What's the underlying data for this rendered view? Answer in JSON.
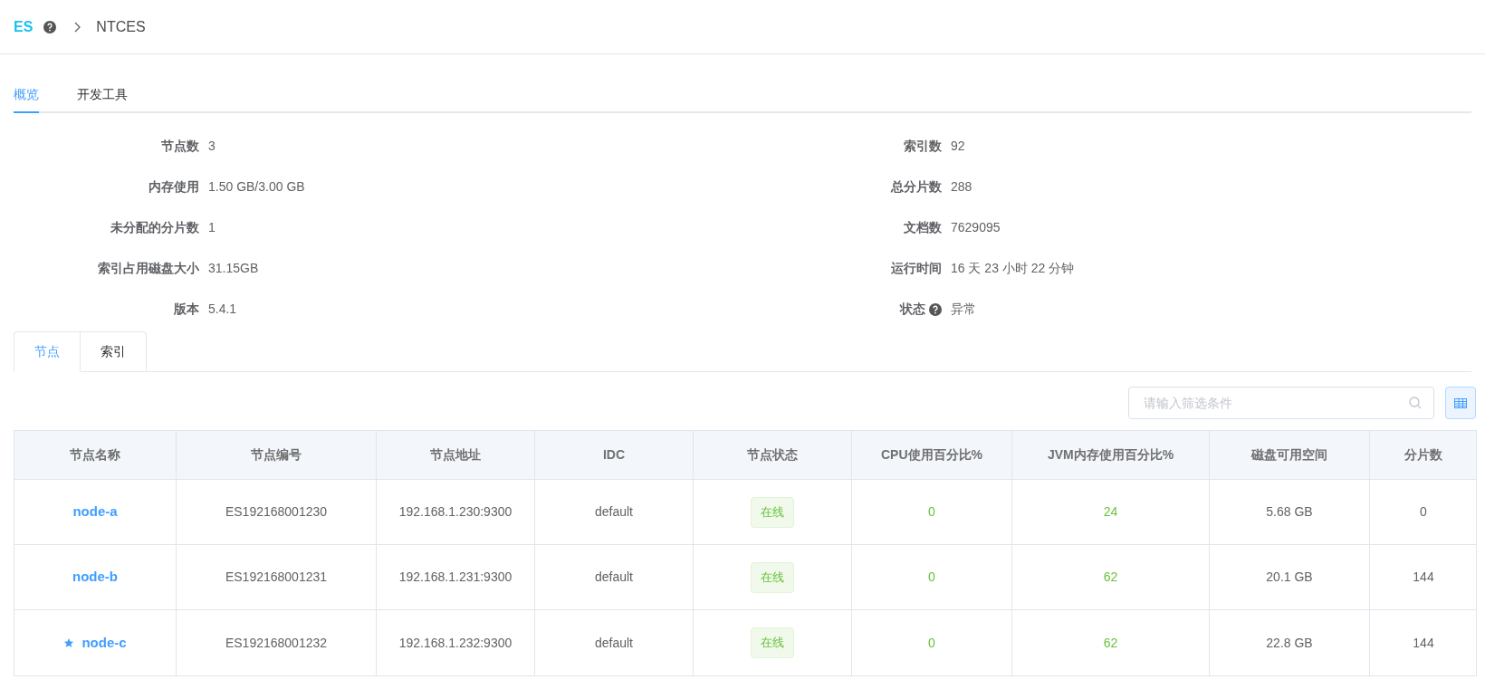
{
  "breadcrumb": {
    "logo": "ES",
    "current": "NTCES"
  },
  "tabs": [
    {
      "label": "概览",
      "selected": true
    },
    {
      "label": "开发工具",
      "selected": false
    }
  ],
  "overview_left": [
    {
      "label": "节点数",
      "value": "3"
    },
    {
      "label": "内存使用",
      "value": "1.50 GB/3.00 GB"
    },
    {
      "label": "未分配的分片数",
      "value": "1"
    },
    {
      "label": "索引占用磁盘大小",
      "value": "31.15GB"
    },
    {
      "label": "版本",
      "value": "5.4.1"
    }
  ],
  "overview_right": [
    {
      "label": "索引数",
      "value": "92",
      "help": false
    },
    {
      "label": "总分片数",
      "value": "288",
      "help": false
    },
    {
      "label": "文档数",
      "value": "7629095",
      "help": false
    },
    {
      "label": "运行时间",
      "value": "16 天 23 小时 22 分钟",
      "help": false
    },
    {
      "label": "状态",
      "value": "异常",
      "help": true
    }
  ],
  "sub_tabs": [
    {
      "label": "节点",
      "selected": true
    },
    {
      "label": "索引",
      "selected": false
    }
  ],
  "search": {
    "placeholder": "请输入筛选条件"
  },
  "table": {
    "columns": [
      "节点名称",
      "节点编号",
      "节点地址",
      "IDC",
      "节点状态",
      "CPU使用百分比%",
      "JVM内存使用百分比%",
      "磁盘可用空间",
      "分片数"
    ],
    "rows": [
      {
        "name": "node-a",
        "master": false,
        "id": "ES192168001230",
        "address": "192.168.1.230:9300",
        "idc": "default",
        "status": {
          "kind": "online",
          "label": "在线"
        },
        "cpu": "0",
        "jvm": "24",
        "disk": "5.68 GB",
        "shards": "0"
      },
      {
        "name": "node-b",
        "master": false,
        "id": "ES192168001231",
        "address": "192.168.1.231:9300",
        "idc": "default",
        "status": {
          "kind": "online",
          "label": "在线"
        },
        "cpu": "0",
        "jvm": "62",
        "disk": "20.1 GB",
        "shards": "144"
      },
      {
        "name": "node-c",
        "master": true,
        "id": "ES192168001232",
        "address": "192.168.1.232:9300",
        "idc": "default",
        "status": {
          "kind": "online",
          "label": "在线"
        },
        "cpu": "0",
        "jvm": "62",
        "disk": "22.8 GB",
        "shards": "144"
      }
    ]
  }
}
